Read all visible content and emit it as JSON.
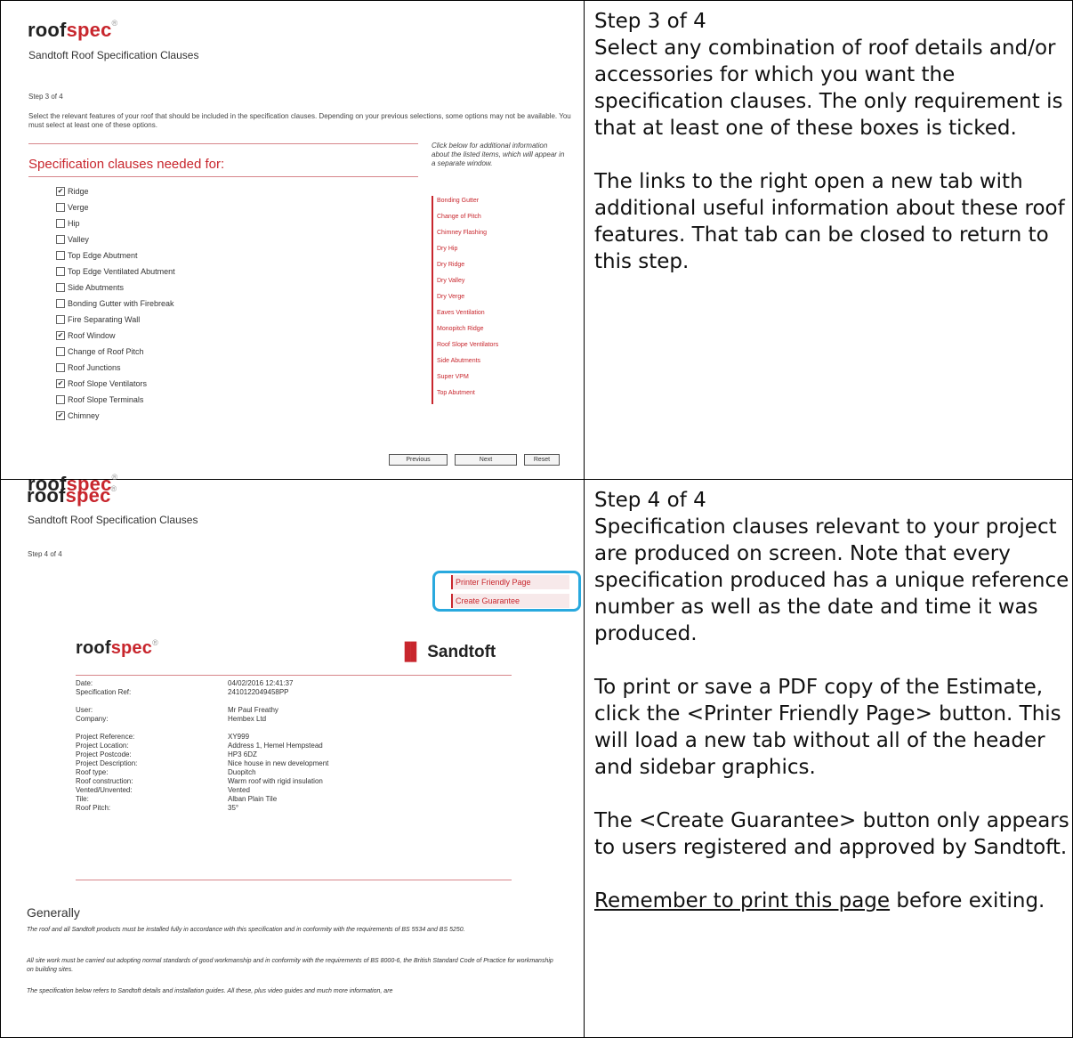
{
  "step3": {
    "logo_roof": "roof",
    "logo_spec": "spec",
    "logo_reg": "®",
    "subtitle": "Sandtoft Roof Specification Clauses",
    "step_label": "Step 3 of 4",
    "instructions": "Select the relevant features of your roof that should be included in the specification clauses. Depending on your previous selections, some options may not be available. You must select at least one of these options.",
    "links_note": "Click below for additional information about the listed items, which will appear in a separate window.",
    "section_title": "Specification clauses needed for:",
    "checkboxes": [
      {
        "label": "Ridge",
        "checked": true
      },
      {
        "label": "Verge",
        "checked": false
      },
      {
        "label": "Hip",
        "checked": false
      },
      {
        "label": "Valley",
        "checked": false
      },
      {
        "label": "Top Edge Abutment",
        "checked": false
      },
      {
        "label": "Top Edge Ventilated Abutment",
        "checked": false
      },
      {
        "label": "Side Abutments",
        "checked": false
      },
      {
        "label": "Bonding Gutter with Firebreak",
        "checked": false
      },
      {
        "label": "Fire Separating Wall",
        "checked": false
      },
      {
        "label": "Roof Window",
        "checked": true
      },
      {
        "label": "Change of Roof Pitch",
        "checked": false
      },
      {
        "label": "Roof Junctions",
        "checked": false
      },
      {
        "label": "Roof Slope Ventilators",
        "checked": true
      },
      {
        "label": "Roof Slope Terminals",
        "checked": false
      },
      {
        "label": "Chimney",
        "checked": true
      }
    ],
    "info_links": [
      "Bonding Gutter",
      "Change of Pitch",
      "Chimney Flashing",
      "Dry Hip",
      "Dry Ridge",
      "Dry Valley",
      "Dry Verge",
      "Eaves Ventilation",
      "Monopitch Ridge",
      "Roof Slope Ventilators",
      "Side Abutments",
      "Super VPM",
      "Top Abutment"
    ],
    "btn_previous": "Previous",
    "btn_next": "Next",
    "btn_reset": "Reset"
  },
  "step3_desc": {
    "title": "Step 3 of 4",
    "body": "Select any combination of roof details and/or accessories for which you want the specification clauses. The only requirement is that at least one of these boxes is ticked.",
    "body2": "The links to the right open a new tab with additional useful information about these roof features. That tab can be closed to return to this step."
  },
  "step4": {
    "logo_roof": "roof",
    "logo_spec": "spec",
    "logo_reg": "®",
    "subtitle": "Sandtoft Roof Specification Clauses",
    "step_label": "Step 4 of 4",
    "printer_link": "Printer Friendly Page",
    "guarantee_link": "Create Guarantee",
    "brand_name": "Sandtoft",
    "details": [
      {
        "k": "Date:",
        "v": "04/02/2016 12:41:37"
      },
      {
        "k": "Specification Ref:",
        "v": "2410122049458PP"
      },
      {
        "k": "User:",
        "v": "Mr Paul Freathy"
      },
      {
        "k": "Company:",
        "v": "Hembex Ltd"
      },
      {
        "k": "Project Reference:",
        "v": "XY999"
      },
      {
        "k": "Project Location:",
        "v": "Address 1, Hemel Hempstead"
      },
      {
        "k": "Project Postcode:",
        "v": "HP3 6DZ"
      },
      {
        "k": "Project Description:",
        "v": "Nice house in new development"
      },
      {
        "k": "Roof type:",
        "v": "Duopitch"
      },
      {
        "k": "Roof construction:",
        "v": "Warm roof with rigid insulation"
      },
      {
        "k": "Vented/Unvented:",
        "v": "Vented"
      },
      {
        "k": "Tile:",
        "v": "Alban Plain Tile"
      },
      {
        "k": "Roof Pitch:",
        "v": "35°"
      }
    ],
    "generally": "Generally",
    "para1": "The roof and all Sandtoft products must be installed fully in accordance with this specification and in conformity with the requirements of BS 5534 and BS 5250.",
    "para2": "All site work must be carried out adopting normal standards of good workmanship and in conformity with the requirements of BS 8000-6, the British Standard Code of Practice for workmanship on building sites.",
    "para3": "The specification below refers to Sandtoft details and installation guides. All these, plus video guides and much more information, are"
  },
  "step4_desc": {
    "title": "Step 4 of 4",
    "body": "Specification clauses relevant to your project are produced on screen.  Note that every specification produced has a unique reference number as well as the date and time it was produced.",
    "body2": "To print or save a PDF copy of the Estimate, click the <Printer Friendly Page> button. This will load a new tab without all of the header and sidebar graphics.",
    "body3": "The <Create Guarantee> button only appears to users registered and approved by Sandtoft.",
    "remember_link": "Remember to print this page",
    "remember_rest": " before exiting."
  }
}
